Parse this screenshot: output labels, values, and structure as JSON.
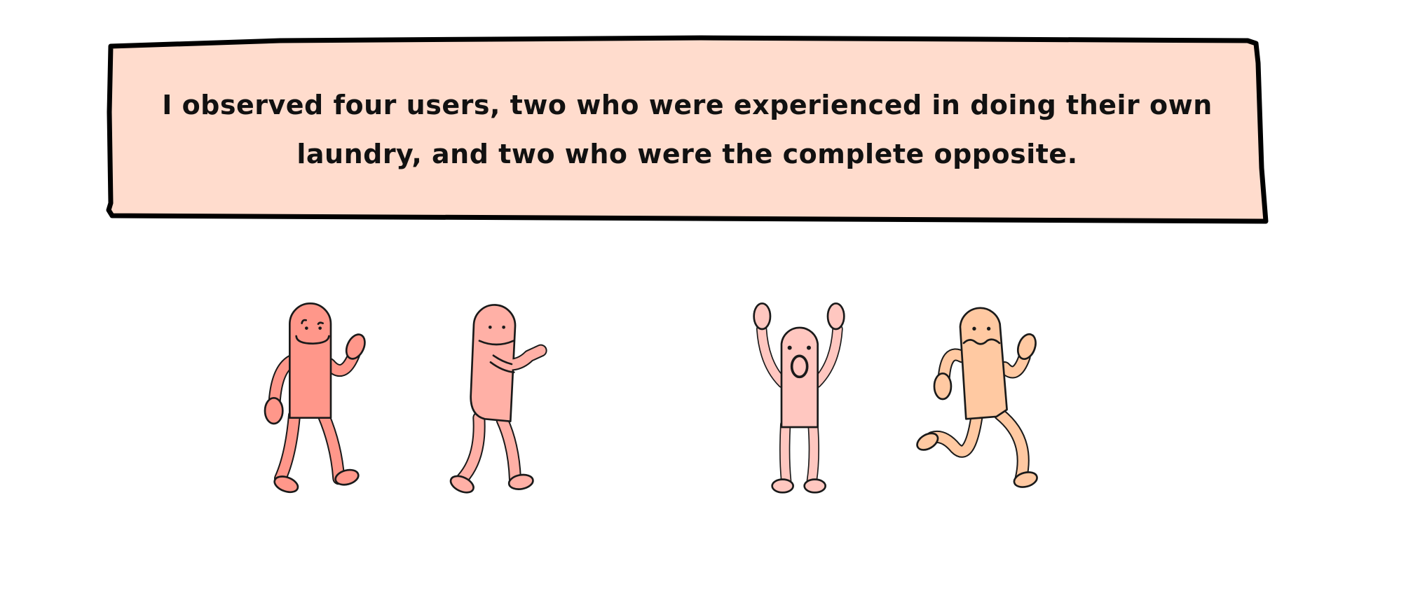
{
  "caption": {
    "line1": "I observed four users, two who were experienced in doing their own",
    "line2": "laundry, and two who were the complete opposite."
  },
  "colors": {
    "banner_fill": "#FFDCCD",
    "outline": "#1a1a1a",
    "figure_1": "#FF978A",
    "figure_2": "#FFB0A6",
    "figure_3": "#FFC7C0",
    "figure_4": "#FFC9A2"
  },
  "figures": [
    {
      "name": "experienced-user-waving"
    },
    {
      "name": "experienced-user-pointing"
    },
    {
      "name": "inexperienced-user-surprised"
    },
    {
      "name": "inexperienced-user-running"
    }
  ]
}
